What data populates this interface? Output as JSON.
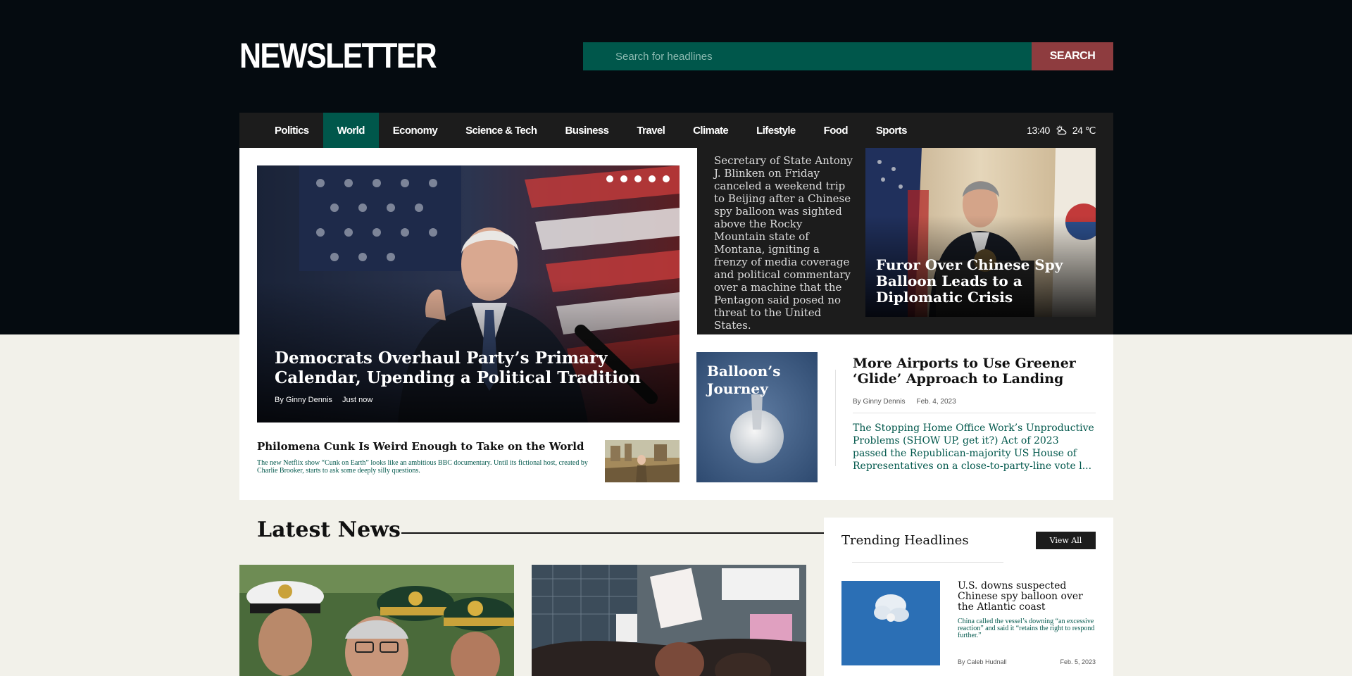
{
  "header": {
    "logo": "NEWSLETTER",
    "search_placeholder": "Search for headlines",
    "search_button": "SEARCH"
  },
  "nav": {
    "items": [
      "Politics",
      "World",
      "Economy",
      "Science & Tech",
      "Business",
      "Travel",
      "Climate",
      "Lifestyle",
      "Food",
      "Sports"
    ],
    "active": "World",
    "time": "13:40",
    "weather_icon": "partly-cloudy-icon",
    "temperature": "24 ℃"
  },
  "hero": {
    "title": "Democrats Overhaul Party’s Primary Calendar, Upending a Political Tradition",
    "author": "By Ginny Dennis",
    "time": "Just now",
    "slides": 5
  },
  "cunk": {
    "title": "Philomena Cunk Is Weird Enough to Take on the World",
    "desc": "The new Netflix show “Cunk on Earth” looks like an ambitious BBC documentary. Until its fictional host, created by Charlie Brooker, starts to ask some deeply silly questions."
  },
  "blinken": {
    "text": "Secretary of State Antony J. Blinken on Friday canceled a weekend trip to Beijing after a Chinese spy balloon was sighted above the Rocky Mountain state of Montana, igniting a frenzy of media coverage and political commentary over a machine that the Pentagon said posed no threat to the United States.",
    "title": "Furor Over Chinese Spy Balloon Leads to a Diplomatic Crisis"
  },
  "balloon": {
    "label": "Balloon’s Journey"
  },
  "airports": {
    "title": "More Airports to Use Greener ‘Glide’ Approach to Landing",
    "author": "By Ginny Dennis",
    "date": "Feb. 4, 2023",
    "desc": "The Stopping Home Office Work’s Unproductive Problems (SHOW UP, get it?) Act of 2023 passed the Republican-majority US House of Representatives on a close-to-party-line vote l..."
  },
  "latest": {
    "heading": "Latest News"
  },
  "trending": {
    "heading": "Trending Headlines",
    "view_all": "View All",
    "item": {
      "title": "U.S. downs suspected Chinese spy balloon over the Atlantic coast",
      "desc": "China called the vessel’s downing “an excessive reaction” and said it “retains the right to respond further.”",
      "author": "By Caleb Hudnall",
      "date": "Feb. 5, 2023"
    }
  },
  "colors": {
    "accent_green": "#00574b",
    "search_red": "#8e3c3f",
    "dark": "#050b10",
    "page_bg": "#f2f1ea"
  }
}
